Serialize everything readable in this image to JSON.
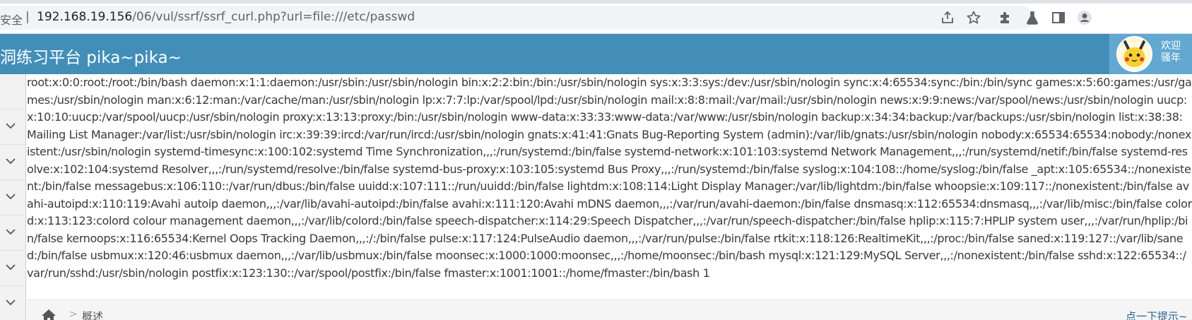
{
  "browser": {
    "security_label": "安全",
    "security_separator": "|",
    "url_host": "192.168.19.156",
    "url_path": "/06/vul/ssrf/ssrf_curl.php?url=file:///etc/passwd",
    "icons": [
      "share-icon",
      "star-icon",
      "extensions-icon",
      "labs-icon",
      "sidebar-icon",
      "profile-icon"
    ]
  },
  "header": {
    "title": "洞练习平台 pika~pika~",
    "welcome_line1": "欢迎",
    "welcome_line2": "骚年",
    "colors": {
      "header_bg": "#438eb9",
      "user_box_bg": "#62a8d1"
    }
  },
  "sidebar": {
    "chevron_count": 6,
    "icon": "chevron-down-icon"
  },
  "output": {
    "text": "root:x:0:0:root:/root:/bin/bash daemon:x:1:1:daemon:/usr/sbin:/usr/sbin/nologin bin:x:2:2:bin:/bin:/usr/sbin/nologin sys:x:3:3:sys:/dev:/usr/sbin/nologin sync:x:4:65534:sync:/bin:/bin/sync games:x:5:60:games:/usr/games:/usr/sbin/nologin man:x:6:12:man:/var/cache/man:/usr/sbin/nologin lp:x:7:7:lp:/var/spool/lpd:/usr/sbin/nologin mail:x:8:8:mail:/var/mail:/usr/sbin/nologin news:x:9:9:news:/var/spool/news:/usr/sbin/nologin uucp:x:10:10:uucp:/var/spool/uucp:/usr/sbin/nologin proxy:x:13:13:proxy:/bin:/usr/sbin/nologin www-data:x:33:33:www-data:/var/www:/usr/sbin/nologin backup:x:34:34:backup:/var/backups:/usr/sbin/nologin list:x:38:38:Mailing List Manager:/var/list:/usr/sbin/nologin irc:x:39:39:ircd:/var/run/ircd:/usr/sbin/nologin gnats:x:41:41:Gnats Bug-Reporting System (admin):/var/lib/gnats:/usr/sbin/nologin nobody:x:65534:65534:nobody:/nonexistent:/usr/sbin/nologin systemd-timesync:x:100:102:systemd Time Synchronization,,,:/run/systemd:/bin/false systemd-network:x:101:103:systemd Network Management,,,:/run/systemd/netif:/bin/false systemd-resolve:x:102:104:systemd Resolver,,,:/run/systemd/resolve:/bin/false systemd-bus-proxy:x:103:105:systemd Bus Proxy,,,:/run/systemd:/bin/false syslog:x:104:108::/home/syslog:/bin/false _apt:x:105:65534::/nonexistent:/bin/false messagebus:x:106:110::/var/run/dbus:/bin/false uuidd:x:107:111::/run/uuidd:/bin/false lightdm:x:108:114:Light Display Manager:/var/lib/lightdm:/bin/false whoopsie:x:109:117::/nonexistent:/bin/false avahi-autoipd:x:110:119:Avahi autoip daemon,,,:/var/lib/avahi-autoipd:/bin/false avahi:x:111:120:Avahi mDNS daemon,,,:/var/run/avahi-daemon:/bin/false dnsmasq:x:112:65534:dnsmasq,,,:/var/lib/misc:/bin/false colord:x:113:123:colord colour management daemon,,,:/var/lib/colord:/bin/false speech-dispatcher:x:114:29:Speech Dispatcher,,,:/var/run/speech-dispatcher:/bin/false hplip:x:115:7:HPLIP system user,,,:/var/run/hplip:/bin/false kernoops:x:116:65534:Kernel Oops Tracking Daemon,,,:/:/bin/false pulse:x:117:124:PulseAudio daemon,,,:/var/run/pulse:/bin/false rtkit:x:118:126:RealtimeKit,,,:/proc:/bin/false saned:x:119:127::/var/lib/saned:/bin/false usbmux:x:120:46:usbmux daemon,,,:/var/lib/usbmux:/bin/false moonsec:x:1000:1000:moonsec,,,:/home/moonsec:/bin/bash mysql:x:121:129:MySQL Server,,,:/nonexistent:/bin/false sshd:x:122:65534::/var/run/sshd:/usr/sbin/nologin postfix:x:123:130::/var/spool/postfix:/bin/false fmaster:x:1001:1001::/home/fmaster:/bin/bash 1"
  },
  "breadcrumb": {
    "separator": ">",
    "current": "概述",
    "hint_link": "点一下提示~"
  }
}
